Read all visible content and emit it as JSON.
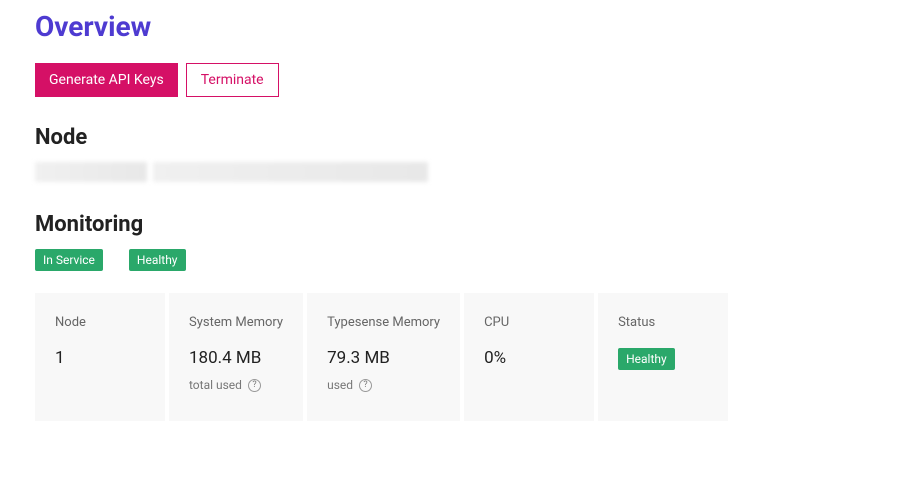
{
  "page": {
    "title": "Overview"
  },
  "actions": {
    "generate_api_keys": "Generate API Keys",
    "terminate": "Terminate"
  },
  "node_section": {
    "heading": "Node"
  },
  "monitoring": {
    "heading": "Monitoring",
    "badges": {
      "in_service": "In Service",
      "healthy": "Healthy"
    },
    "cards": {
      "node": {
        "label": "Node",
        "value": "1"
      },
      "system_memory": {
        "label": "System Memory",
        "value": "180.4 MB",
        "sub": "total used"
      },
      "typesense_memory": {
        "label": "Typesense Memory",
        "value": "79.3 MB",
        "sub": "used"
      },
      "cpu": {
        "label": "CPU",
        "value": "0%"
      },
      "status": {
        "label": "Status",
        "badge": "Healthy"
      }
    }
  }
}
